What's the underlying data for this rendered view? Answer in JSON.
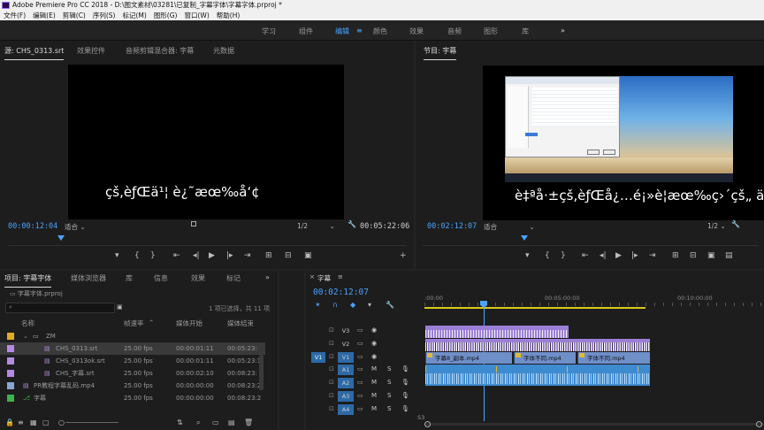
{
  "app": {
    "title": "Adobe Premiere Pro CC 2018 - D:\\图文素材\\03281\\已复制_字幕字体\\字幕字体.prproj *"
  },
  "menu": [
    "文件(F)",
    "编辑(E)",
    "剪辑(C)",
    "序列(S)",
    "标记(M)",
    "图形(G)",
    "窗口(W)",
    "帮助(H)"
  ],
  "workspaces": [
    "学习",
    "组件",
    "编辑",
    "颜色",
    "效果",
    "音频",
    "图形",
    "库"
  ],
  "workspace_active": "编辑",
  "source_panel": {
    "tabs": [
      "源: CHS_0313.srt",
      "效果控件",
      "音频剪辑混合器: 字幕",
      "元数据"
    ],
    "caption": "çš‚èƒŒä¹¦ è¿˜æœ‰å‘¢",
    "timecode_in": "00:00:12:04",
    "fit": "适合",
    "resolution": "1/2",
    "timecode_out": "00:05:22:06"
  },
  "program_panel": {
    "tab": "节目: 字幕",
    "caption": "è‡ªå·±çš‚èƒŒå¿…é¡»è¦æœ‰ç›´çš„ ä",
    "timecode_in": "00:02:12:07",
    "fit": "适合",
    "resolution": "1/2",
    "timecode_out": "00:05:22:06"
  },
  "project_panel": {
    "tabs": [
      "项目: 字幕字体",
      "媒体浏览器",
      "库",
      "信息",
      "效果",
      "标记"
    ],
    "project_file": "字幕字体.prproj",
    "selection_info": "1 项已选择，共 11 项",
    "columns": [
      "名称",
      "帧速率",
      "媒体开始",
      "媒体结束"
    ],
    "rows": [
      {
        "name": "ZM",
        "fps": "",
        "start": "",
        "end": "",
        "color": "#e3a92a",
        "type": "folder",
        "indent": 1
      },
      {
        "name": "CHS_0313.srt",
        "fps": "25.00 fps",
        "start": "00:00:01:11",
        "end": "00:05:23:",
        "color": "#b48be0",
        "type": "file",
        "indent": 2
      },
      {
        "name": "CHS_0313ok.srt",
        "fps": "25.00 fps",
        "start": "00:00:01:11",
        "end": "00:05:23:1",
        "color": "#b48be0",
        "type": "file",
        "indent": 2
      },
      {
        "name": "CHS_字幕.srt",
        "fps": "25.00 fps",
        "start": "00:00:02:10",
        "end": "00:08:23:",
        "color": "#b48be0",
        "type": "file",
        "indent": 2
      },
      {
        "name": "PR教程字幕乱码.mp4",
        "fps": "25.00 fps",
        "start": "00:00:00:00",
        "end": "00:08:23:2",
        "color": "#8aa4d6",
        "type": "video",
        "indent": 1
      },
      {
        "name": "字幕",
        "fps": "25.00 fps",
        "start": "00:00:00:00",
        "end": "00:08:23:2",
        "color": "#3fb24b",
        "type": "sequence",
        "indent": 1
      }
    ]
  },
  "timeline": {
    "tab": "字幕",
    "timecode": "00:02:12:07",
    "ruler_labels": [
      ":00:00",
      "00:05:00:00",
      "00:10:00:00"
    ],
    "tracks": [
      "V3",
      "V2",
      "V1",
      "A1",
      "A2",
      "A3",
      "A4"
    ],
    "source_patch_v": "V1",
    "clips_v1": [
      "字幕8_副本.mp4",
      "字体不同.mp4",
      "字体不同.mp4"
    ],
    "meter_label": "S3"
  },
  "colors": {
    "accent": "#4aa3ff",
    "v3_clip": "#9b7fd6",
    "v1_clip": "#6f8fc9",
    "audio_clip": "#3f8bd0",
    "timeline_work_area": "#d7c91e"
  }
}
